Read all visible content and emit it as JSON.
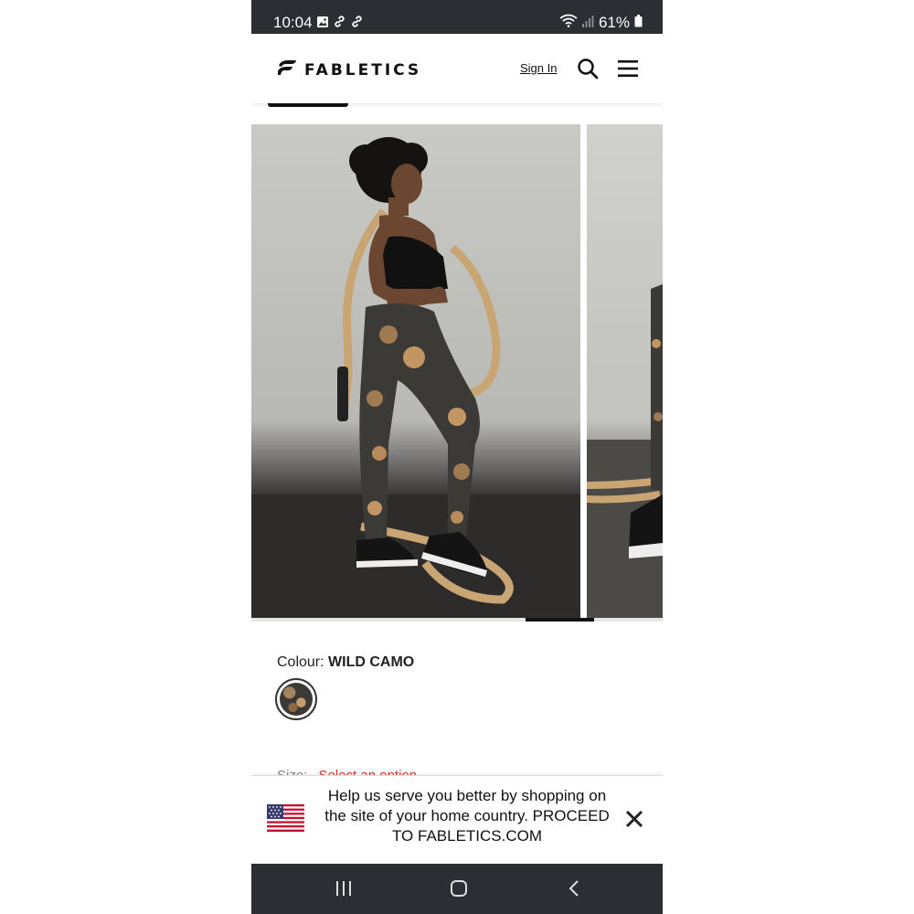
{
  "status_bar": {
    "time": "10:04",
    "battery": "61%",
    "left_icons": [
      "image-icon",
      "link-icon",
      "link-icon"
    ],
    "right_icons": [
      "wifi-icon",
      "signal-icon",
      "battery-icon"
    ]
  },
  "header": {
    "brand": "FABLETICS",
    "sign_in": "Sign In",
    "icons": [
      "search-icon",
      "menu-icon"
    ]
  },
  "gallery": {
    "images": [
      "product-image-1",
      "product-image-2"
    ],
    "active_index": 0
  },
  "product": {
    "colour_label": "Colour:",
    "colour_value": "WILD CAMO",
    "size_label": "Size:",
    "size_placeholder": "Select an option"
  },
  "banner": {
    "message": "Help us serve you better by shopping on the site of your home country. PROCEED TO FABLETICS.COM",
    "flag": "us-flag-icon"
  },
  "nav": {
    "buttons": [
      "recent-apps-icon",
      "home-icon",
      "back-icon"
    ]
  },
  "colors": {
    "status_bar_bg": "#2c2e33",
    "accent_red": "#d9332b",
    "text": "#111111"
  }
}
